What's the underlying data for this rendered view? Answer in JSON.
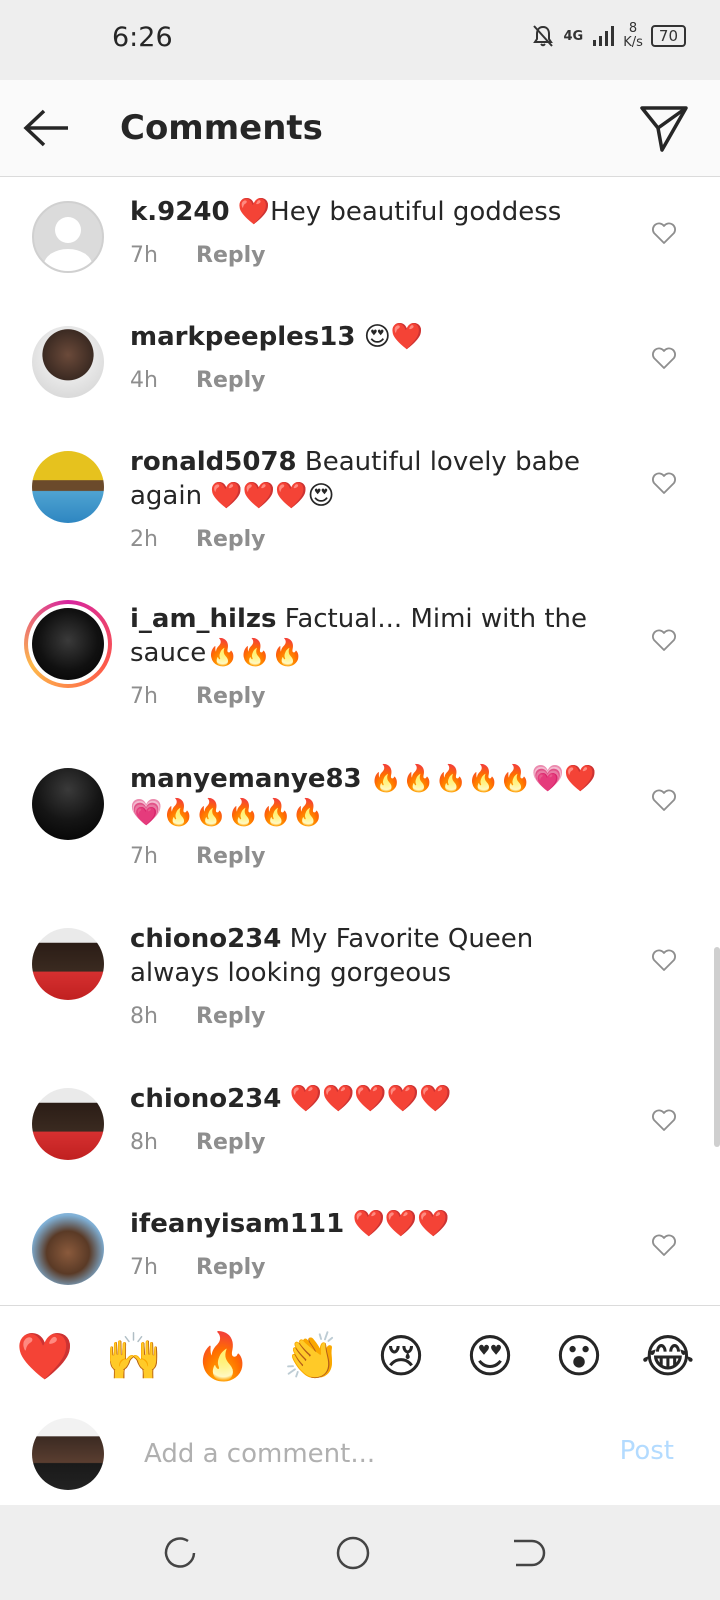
{
  "status_bar": {
    "time": "6:26",
    "network": "4G",
    "speed_value": "8",
    "speed_unit": "K/s",
    "battery": "70"
  },
  "header": {
    "title": "Comments",
    "back_icon": "arrow-left-icon",
    "share_icon": "paper-plane-icon"
  },
  "comments": [
    {
      "username": "k.9240",
      "text": "❤️Hey beautiful goddess",
      "time": "7h",
      "reply": "Reply",
      "avatar": "default-avatar"
    },
    {
      "username": "markpeeples13",
      "text": "😍❤️",
      "time": "4h",
      "reply": "Reply",
      "avatar": "photo"
    },
    {
      "username": "ronald5078",
      "text": "Beautiful lovely babe again ❤️❤️❤️😍",
      "time": "2h",
      "reply": "Reply",
      "avatar": "photo"
    },
    {
      "username": "i_am_hilzs",
      "text": "Factual... Mimi with the sauce🔥🔥🔥",
      "time": "7h",
      "reply": "Reply",
      "avatar": "story-ring-photo"
    },
    {
      "username": "manyemanye83",
      "text": "🔥🔥🔥🔥🔥💗❤️💗🔥🔥🔥🔥🔥",
      "time": "7h",
      "reply": "Reply",
      "avatar": "photo"
    },
    {
      "username": "chiono234",
      "text": "My Favorite Queen always looking gorgeous",
      "time": "8h",
      "reply": "Reply",
      "avatar": "photo"
    },
    {
      "username": "chiono234",
      "text": "❤️❤️❤️❤️❤️",
      "time": "8h",
      "reply": "Reply",
      "avatar": "photo"
    },
    {
      "username": "ifeanyisam111",
      "text": "❤️❤️❤️",
      "time": "7h",
      "reply": "Reply",
      "avatar": "photo"
    }
  ],
  "reactions": [
    "❤️",
    "🙌",
    "🔥",
    "👏",
    "😢",
    "😍",
    "😮",
    "😂"
  ],
  "composer": {
    "placeholder": "Add a comment...",
    "post_label": "Post"
  },
  "colors": {
    "text": "#262626",
    "secondary": "#8e8e8e",
    "post_disabled": "#b3dbff",
    "heart": "#ed4956"
  }
}
